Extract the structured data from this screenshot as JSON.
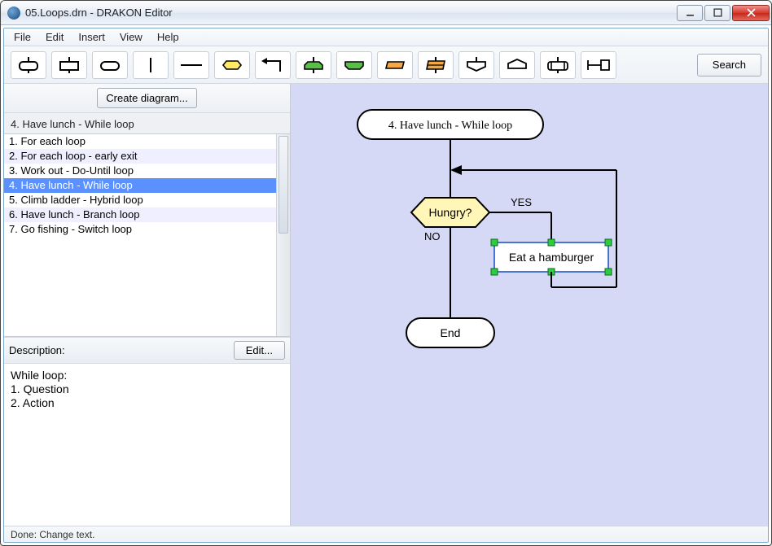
{
  "window": {
    "title": "05.Loops.drn - DRAKON Editor"
  },
  "menu": {
    "file": "File",
    "edit": "Edit",
    "insert": "Insert",
    "view": "View",
    "help": "Help"
  },
  "toolbar": {
    "search": "Search"
  },
  "sidebar": {
    "create_diagram": "Create diagram...",
    "current_title": "4. Have lunch - While loop",
    "items": [
      {
        "label": "1. For each loop"
      },
      {
        "label": "2. For each loop - early exit"
      },
      {
        "label": "3. Work out - Do-Until loop"
      },
      {
        "label": "4. Have lunch - While loop"
      },
      {
        "label": "5. Climb ladder - Hybrid loop"
      },
      {
        "label": "6. Have lunch - Branch loop"
      },
      {
        "label": "7. Go fishing - Switch loop"
      }
    ],
    "selected_index": 3,
    "description_label": "Description:",
    "edit_label": "Edit...",
    "description_text": "While loop:\n1. Question\n2. Action"
  },
  "diagram": {
    "title": "4. Have lunch - While loop",
    "question": "Hungry?",
    "yes": "YES",
    "no": "NO",
    "action": "Eat a hamburger",
    "end": "End"
  },
  "status": {
    "text": "Done: Change text."
  }
}
